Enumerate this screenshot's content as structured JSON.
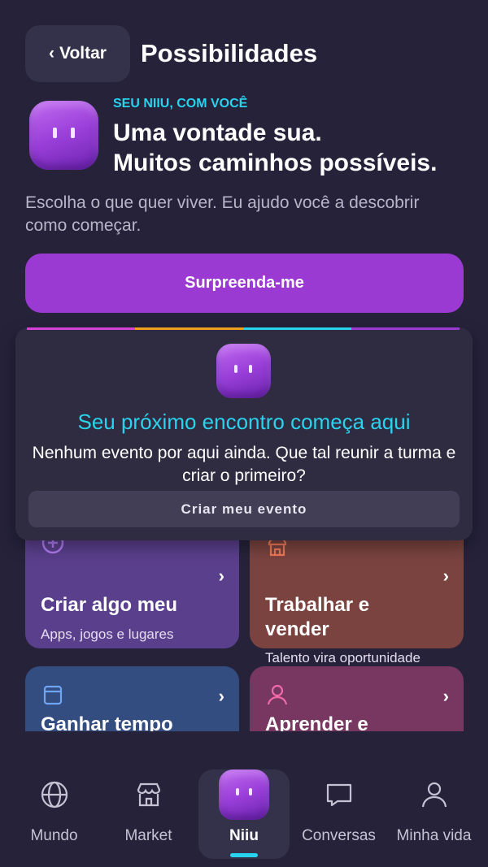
{
  "header": {
    "back_label": "Voltar",
    "back_chevron": "‹",
    "title": "Possibilidades"
  },
  "hero": {
    "kicker": "SEU NIIU, COM VOCÊ",
    "title_line1": "Uma vontade sua.",
    "title_line2": "Muitos caminhos possíveis.",
    "description": "Escolha o que quer viver. Eu ajudo você a descobrir como começar."
  },
  "surprise_button": "Surpreenda-me",
  "event_card": {
    "stripe_colors": [
      "#d63fd8",
      "#f0a020",
      "#27d3ef",
      "#9a3ad2"
    ],
    "title": "Seu próximo encontro começa aqui",
    "description": "Nenhum evento por aqui ainda. Que tal reunir a turma e criar o primeiro?",
    "button_label": "Criar meu evento"
  },
  "cards": [
    {
      "icon": "plus-circle-icon",
      "title": "Criar algo meu",
      "subtitle": "Apps, jogos e lugares",
      "chevron": "›"
    },
    {
      "icon": "store-icon",
      "title_line1": "Trabalhar e",
      "title_line2": "vender",
      "subtitle": "Talento vira oportunidade",
      "chevron": "›"
    },
    {
      "icon": "calendar-icon",
      "title": "Ganhar tempo",
      "chevron": "›"
    },
    {
      "icon": "person-icon",
      "title": "Aprender e",
      "chevron": "›"
    }
  ],
  "tabbar": {
    "tabs": [
      {
        "icon": "globe-icon",
        "label": "Mundo"
      },
      {
        "icon": "shop-icon",
        "label": "Market"
      },
      {
        "icon": "niiu-mascot-icon",
        "label": "Niiu",
        "active": true
      },
      {
        "icon": "chat-icon",
        "label": "Conversas"
      },
      {
        "icon": "user-icon",
        "label": "Minha vida"
      }
    ]
  },
  "colors": {
    "background": "#25223a",
    "accent_purple": "#9a3ad2",
    "accent_cyan": "#27d3ef"
  }
}
